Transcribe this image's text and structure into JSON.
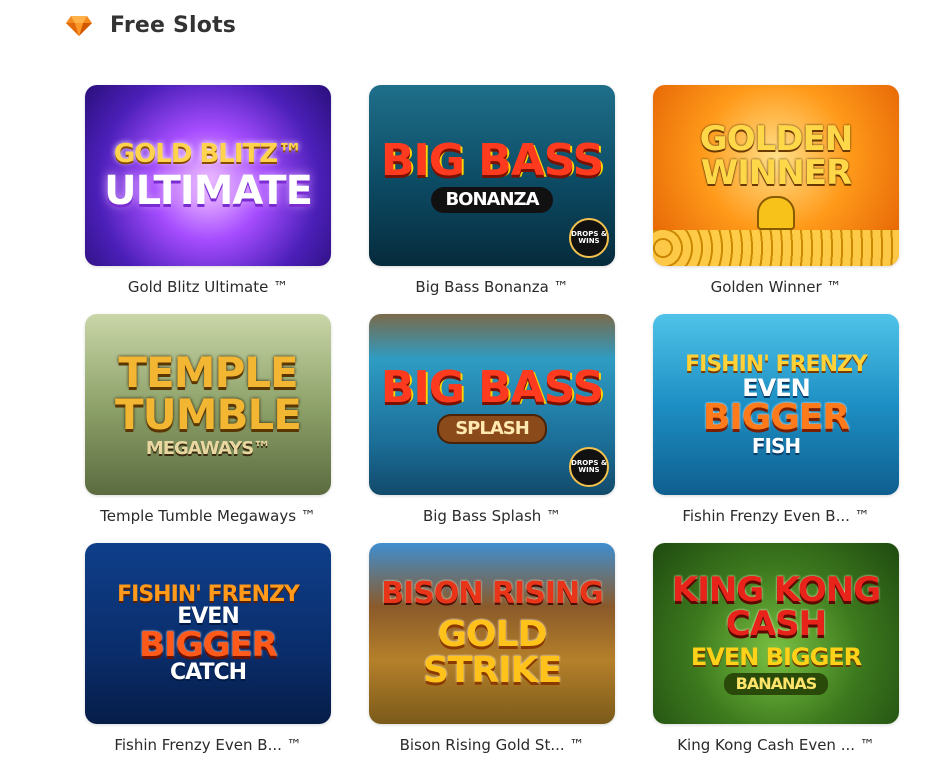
{
  "section": {
    "title": "Free Slots",
    "icon": "gem-icon",
    "accent_color": "#f58a1f"
  },
  "games": [
    {
      "name": "Gold Blitz Ultimate ™",
      "art": [
        "GOLD BLITZ™",
        "ULTIMATE"
      ]
    },
    {
      "name": "Big Bass Bonanza ™",
      "art": [
        "BIG BASS",
        "BONANZA"
      ],
      "badge": "DROPS & WINS"
    },
    {
      "name": "Golden Winner ™",
      "art": [
        "GOLDEN",
        "WINNER"
      ]
    },
    {
      "name": "Temple Tumble Megaways ™",
      "art": [
        "TEMPLE",
        "TUMBLE",
        "MEGAWAYS™"
      ]
    },
    {
      "name": "Big Bass Splash ™",
      "art": [
        "BIG BASS",
        "SPLASH"
      ],
      "badge": "DROPS & WINS"
    },
    {
      "name": "Fishin Frenzy Even B... ™",
      "art": [
        "FISHIN' FRENZY",
        "EVEN",
        "BIGGER",
        "FISH"
      ]
    },
    {
      "name": "Fishin Frenzy Even B... ™",
      "art": [
        "FISHIN' FRENZY",
        "EVEN",
        "BIGGER",
        "CATCH"
      ]
    },
    {
      "name": "Bison Rising Gold St... ™",
      "art": [
        "BISON RISING",
        "GOLD STRIKE"
      ]
    },
    {
      "name": "King Kong Cash Even ... ™",
      "art": [
        "KING KONG CASH",
        "EVEN BIGGER",
        "BANANAS"
      ]
    }
  ]
}
